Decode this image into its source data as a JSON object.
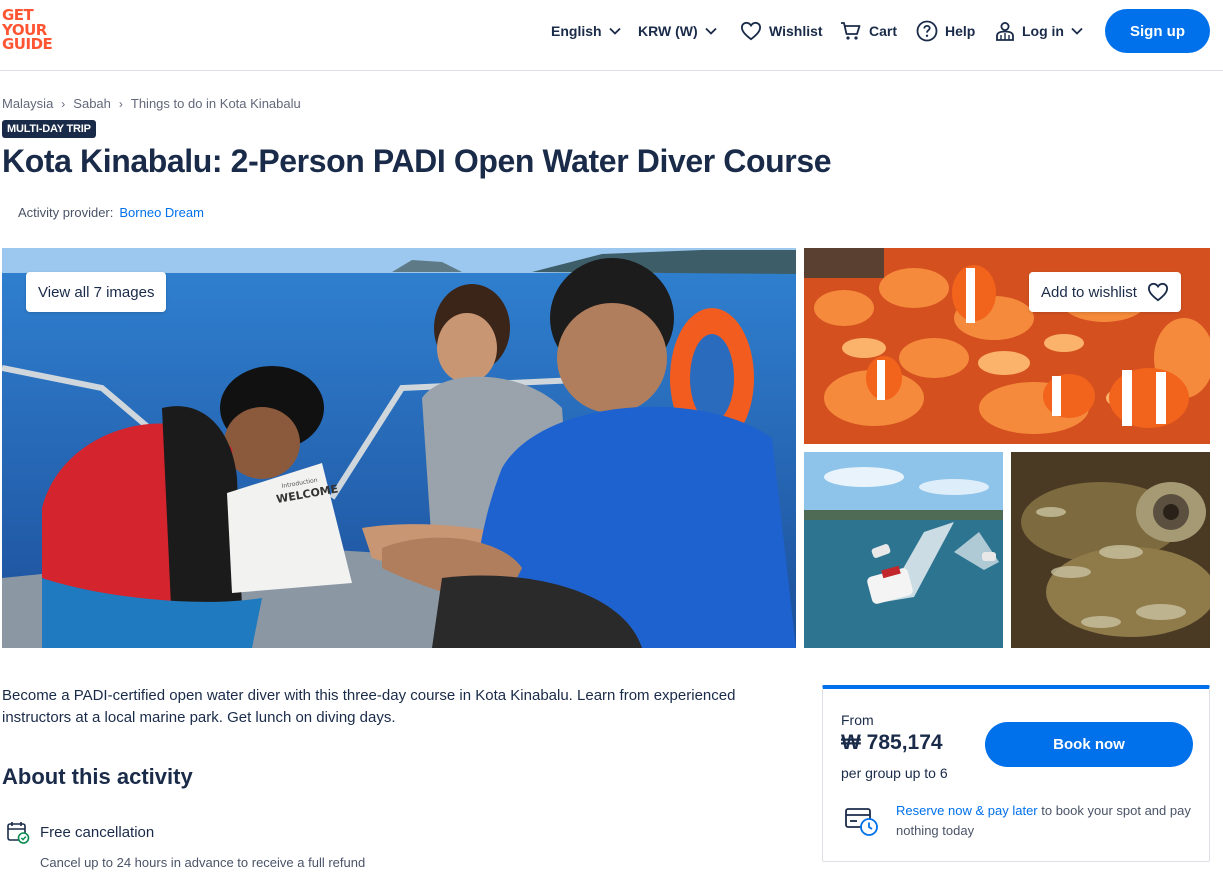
{
  "header": {
    "logo_lines": [
      "GET",
      "YOUR",
      "GUIDE"
    ],
    "language": "English",
    "currency": "KRW (W)",
    "wishlist": "Wishlist",
    "cart": "Cart",
    "help": "Help",
    "login": "Log in",
    "signup": "Sign up"
  },
  "breadcrumb": [
    "Malaysia",
    "Sabah",
    "Things to do in Kota Kinabalu"
  ],
  "badge": "MULTI-DAY TRIP",
  "title": "Kota Kinabalu: 2-Person PADI Open Water Diver Course",
  "provider": {
    "label": "Activity provider:",
    "name": "Borneo Dream"
  },
  "gallery": {
    "view_all": "View all 7 images",
    "add_wishlist": "Add to wishlist",
    "sign_heading": "WELCOME",
    "sign_sub": "Introduction"
  },
  "description": "Become a PADI-certified open water diver with this three-day course in Kota Kinabalu. Learn from experienced instructors at a local marine park. Get lunch on diving days.",
  "about": {
    "heading": "About this activity",
    "free_cancellation": "Free cancellation",
    "free_cancellation_sub": "Cancel up to 24 hours in advance to receive a full refund"
  },
  "booking": {
    "from": "From",
    "price": "₩ 785,174",
    "per": "per group up to 6",
    "book_now": "Book now",
    "reserve_link": "Reserve now & pay later",
    "reserve_text": " to book your spot and pay nothing today"
  },
  "colors": {
    "accent": "#0071eb",
    "brand": "#ff5533",
    "text": "#1a2b49"
  }
}
